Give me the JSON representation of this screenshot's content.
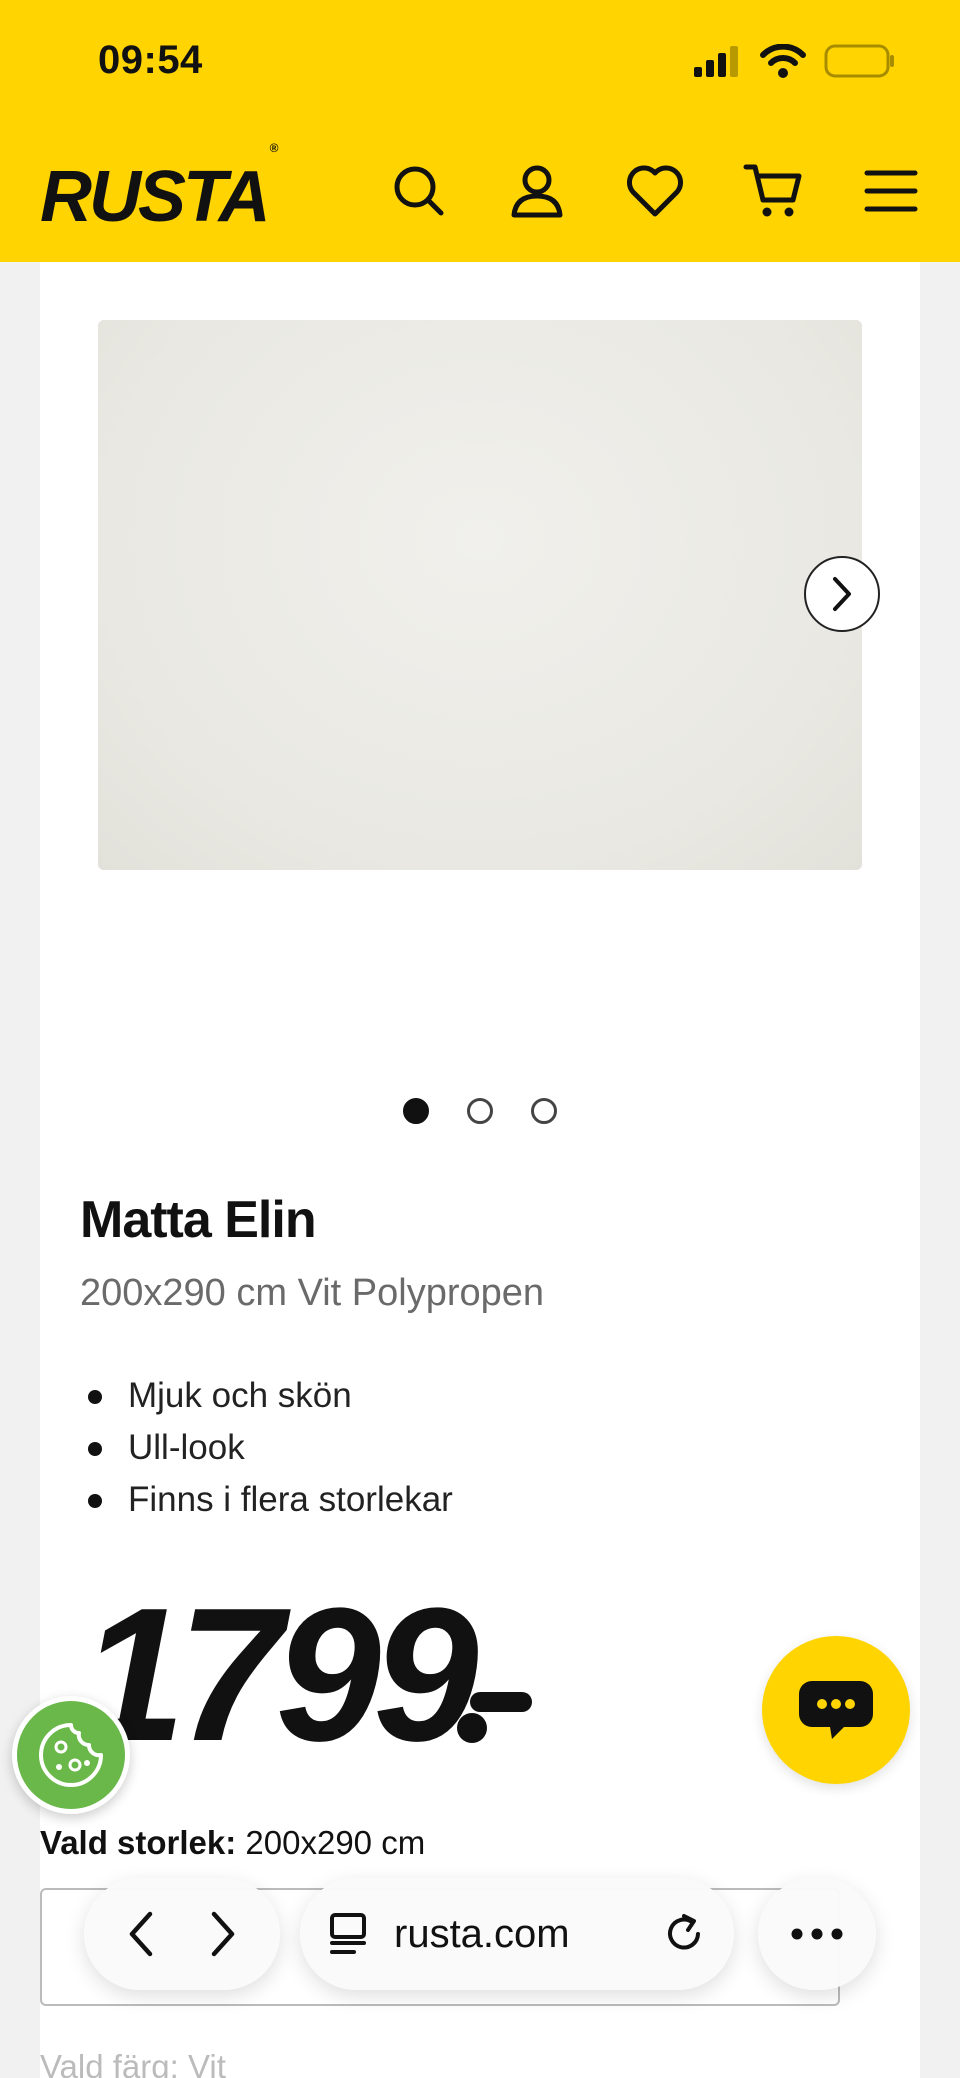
{
  "status_bar": {
    "time": "09:54"
  },
  "header": {
    "logo": "RUSTA",
    "logo_mark": "®",
    "background_color": "#ffd400",
    "icons": [
      "search-icon",
      "account-icon",
      "heart-icon",
      "cart-icon",
      "menu-icon"
    ]
  },
  "gallery": {
    "total_images": 3,
    "active_index": 0
  },
  "product": {
    "title": "Matta Elin",
    "subtitle": "200x290 cm Vit Polypropen",
    "features": [
      "Mjuk och skön",
      "Ull-look",
      "Finns i flera storlekar"
    ],
    "price": "1799"
  },
  "options": {
    "size_label": "Vald storlek:",
    "size_value": "200x290 cm",
    "color_label": "Vald färg:",
    "color_value": "Vit"
  },
  "browser": {
    "url": "rusta.com"
  }
}
